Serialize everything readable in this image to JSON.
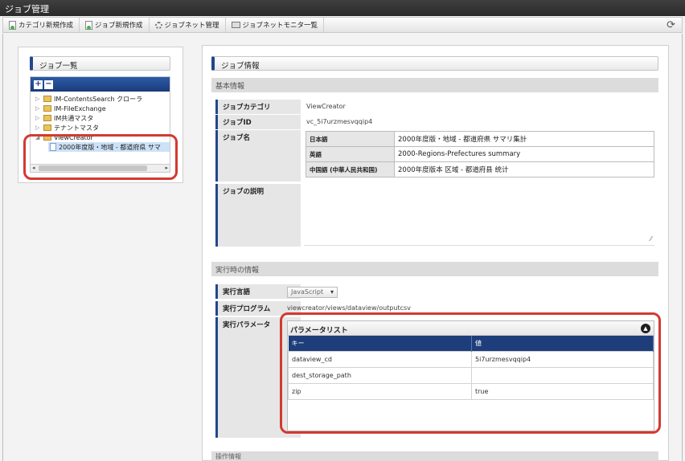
{
  "window": {
    "title": "ジョブ管理"
  },
  "toolbar": {
    "items": [
      "カテゴリ新規作成",
      "ジョブ新規作成",
      "ジョブネット管理",
      "ジョブネットモニタ一覧"
    ],
    "refresh_icon": "refresh-icon"
  },
  "left": {
    "heading": "ジョブ一覧",
    "tree": [
      {
        "label": "IM-ContentsSearch クローラ"
      },
      {
        "label": "IM-FileExchange"
      },
      {
        "label": "IM共通マスタ"
      },
      {
        "label": "テナントマスタ"
      },
      {
        "label": "ViewCreator"
      },
      {
        "label": "2000年度版・地域 - 都道府県 サマ"
      }
    ]
  },
  "right": {
    "heading": "ジョブ情報",
    "basic_section": "基本情報",
    "category_label": "ジョブカテゴリ",
    "category_value": "ViewCreator",
    "id_label": "ジョブID",
    "id_value": "vc_5i7urzmesvqqip4",
    "name_label": "ジョブ名",
    "names": [
      {
        "lang": "日本語",
        "value": "2000年度版・地域 - 都道府県 サマリ集計"
      },
      {
        "lang": "英語",
        "value": "2000-Regions-Prefectures summary"
      },
      {
        "lang": "中国語 (中華人民共和国)",
        "value": "2000年度版本 区域 - 都道府县 统计"
      }
    ],
    "desc_label": "ジョブの説明",
    "runtime_section": "実行時の情報",
    "lang_label": "実行言語",
    "lang_value": "JavaScript",
    "program_label": "実行プログラム",
    "program_value": "viewcreator/views/dataview/outputcsv",
    "params_label": "実行パラメータ",
    "params_title": "パラメータリスト",
    "params_headers": [
      "キー",
      "値"
    ],
    "params": [
      {
        "key": "dataview_cd",
        "value": "5i7urzmesvqqip4"
      },
      {
        "key": "dest_storage_path",
        "value": ""
      },
      {
        "key": "zip",
        "value": "true"
      }
    ],
    "bottom_section": "操作情報"
  }
}
